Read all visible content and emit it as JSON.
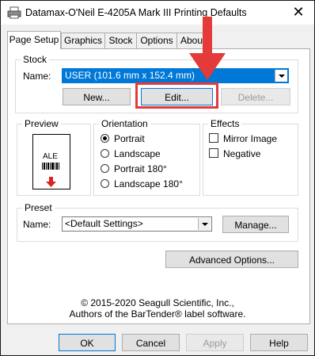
{
  "window": {
    "title": "Datamax-O'Neil E-4205A Mark III Printing Defaults",
    "close_glyph": "✕"
  },
  "tabs": [
    {
      "label": "Page Setup"
    },
    {
      "label": "Graphics"
    },
    {
      "label": "Stock"
    },
    {
      "label": "Options"
    },
    {
      "label": "Abou"
    }
  ],
  "stock": {
    "legend": "Stock",
    "name_label": "Name:",
    "name_value": "USER (101.6 mm x 152.4 mm)",
    "new_button": "New...",
    "edit_button": "Edit...",
    "delete_button": "Delete..."
  },
  "preview": {
    "legend": "Preview",
    "label_text": "ALE"
  },
  "orientation": {
    "legend": "Orientation",
    "options": [
      {
        "label": "Portrait",
        "checked": true
      },
      {
        "label": "Landscape",
        "checked": false
      },
      {
        "label": "Portrait 180°",
        "checked": false
      },
      {
        "label": "Landscape 180°",
        "checked": false
      }
    ]
  },
  "effects": {
    "legend": "Effects",
    "options": [
      {
        "label": "Mirror Image",
        "checked": false
      },
      {
        "label": "Negative",
        "checked": false
      }
    ]
  },
  "preset": {
    "legend": "Preset",
    "name_label": "Name:",
    "name_value": "<Default Settings>",
    "manage_button": "Manage..."
  },
  "advanced_button": "Advanced Options...",
  "copyright": {
    "line1": "© 2015-2020 Seagull Scientific, Inc.,",
    "line2": "Authors of the BarTender® label software."
  },
  "footer": {
    "ok": "OK",
    "cancel": "Cancel",
    "apply": "Apply",
    "help": "Help"
  },
  "colors": {
    "selection": "#0078d7",
    "annotation_red": "#e53a3a"
  }
}
